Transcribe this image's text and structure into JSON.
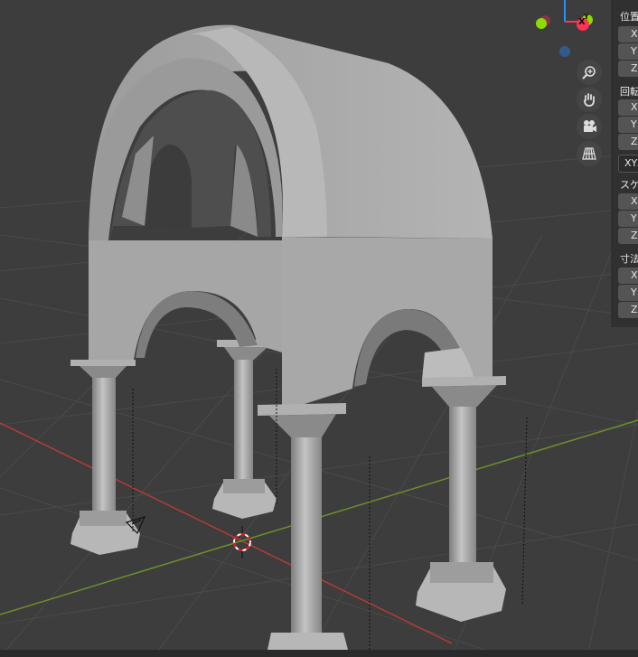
{
  "gizmo": {
    "axis_x_label": "X",
    "axis_y_label": "Y",
    "colors": {
      "x": "#ff3352",
      "y": "#8bdc00",
      "z": "#2890ff",
      "neg_z": "#345a8c"
    }
  },
  "nav_tools": [
    "zoom-icon",
    "hand-pan-icon",
    "camera-icon",
    "grid-perspective-icon"
  ],
  "npanel": {
    "location": {
      "label": "位置",
      "fields": [
        "X",
        "Y",
        "Z"
      ]
    },
    "rotation": {
      "label": "回転",
      "fields": [
        "X",
        "Y",
        "Z"
      ],
      "mode": "XYZ"
    },
    "scale": {
      "label": "スケ",
      "fields": [
        "X",
        "Y",
        "Z"
      ]
    },
    "dimensions": {
      "label": "寸法",
      "fields": [
        "X",
        "Y",
        "Z"
      ]
    }
  },
  "colors": {
    "background": "#3d3d3d",
    "axis_x_line": "#b83a3a",
    "axis_y_line": "#6f8f2a",
    "model": "#a6a6a6"
  }
}
